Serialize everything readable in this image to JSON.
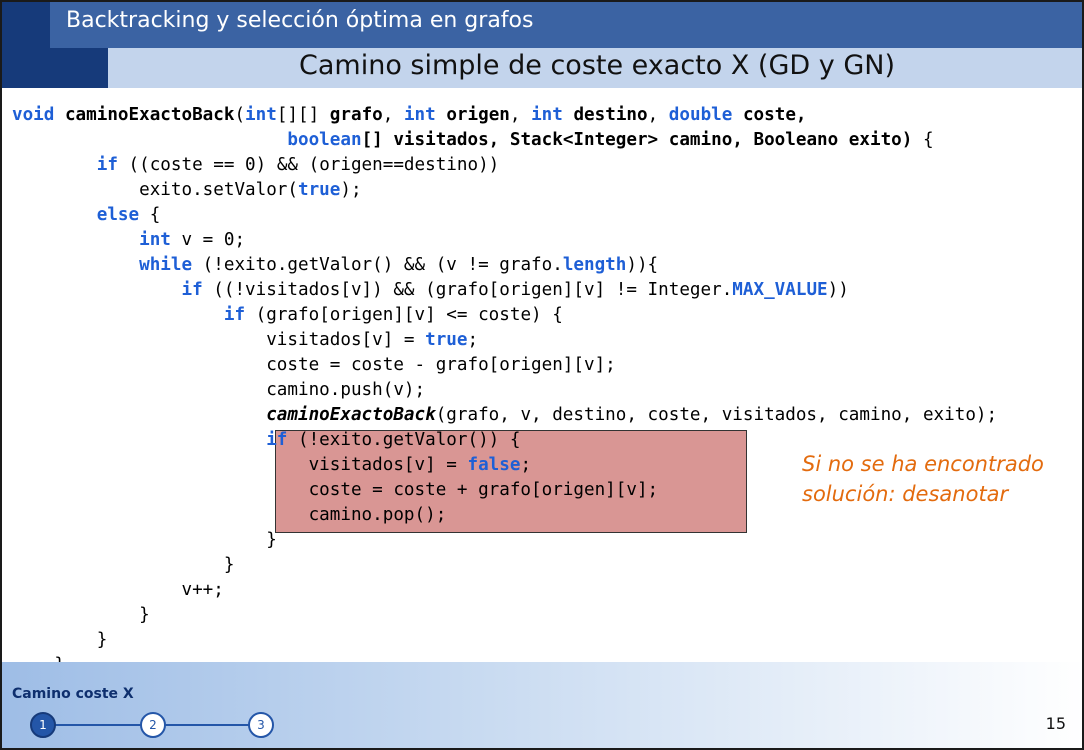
{
  "header": {
    "title": "Backtracking y selección óptima en grafos",
    "subtitle": "Camino simple de coste exacto X (GD y GN)"
  },
  "code": {
    "lines": [
      [
        {
          "t": "void",
          "c": "kw"
        },
        {
          "t": " "
        },
        {
          "t": "caminoExactoBack",
          "c": "b"
        },
        {
          "t": "("
        },
        {
          "t": "int",
          "c": "kw"
        },
        {
          "t": "[][] "
        },
        {
          "t": "grafo",
          "c": "b"
        },
        {
          "t": ", "
        },
        {
          "t": "int",
          "c": "kw"
        },
        {
          "t": " "
        },
        {
          "t": "origen",
          "c": "b"
        },
        {
          "t": ", "
        },
        {
          "t": "int",
          "c": "kw"
        },
        {
          "t": " "
        },
        {
          "t": "destino",
          "c": "b"
        },
        {
          "t": ", "
        },
        {
          "t": "double",
          "c": "kw"
        },
        {
          "t": " "
        },
        {
          "t": "coste,",
          "c": "b"
        }
      ],
      [
        {
          "t": "                          "
        },
        {
          "t": "boolean",
          "c": "kw"
        },
        {
          "t": "[] visitados, Stack<Integer> camino, Booleano exito)",
          "c": "b"
        },
        {
          "t": " {"
        }
      ],
      [
        {
          "t": "        "
        },
        {
          "t": "if",
          "c": "kw"
        },
        {
          "t": " ((coste == 0) && (origen==destino))"
        }
      ],
      [
        {
          "t": "            exito.setValor("
        },
        {
          "t": "true",
          "c": "kw"
        },
        {
          "t": ");"
        }
      ],
      [
        {
          "t": "        "
        },
        {
          "t": "else",
          "c": "kw"
        },
        {
          "t": " {"
        }
      ],
      [
        {
          "t": "            "
        },
        {
          "t": "int",
          "c": "kw"
        },
        {
          "t": " v = 0;"
        }
      ],
      [
        {
          "t": "            "
        },
        {
          "t": "while",
          "c": "kw"
        },
        {
          "t": " (!exito.getValor() && (v != grafo."
        },
        {
          "t": "length",
          "c": "kw"
        },
        {
          "t": ")){"
        }
      ],
      [
        {
          "t": "                "
        },
        {
          "t": "if",
          "c": "kw"
        },
        {
          "t": " ((!visitados[v]) && (grafo[origen][v] != Integer."
        },
        {
          "t": "MAX_VALUE",
          "c": "kw"
        },
        {
          "t": "))"
        }
      ],
      [
        {
          "t": "                    "
        },
        {
          "t": "if",
          "c": "kw"
        },
        {
          "t": " (grafo[origen][v] <= coste) {"
        }
      ],
      [
        {
          "t": "                        visitados[v] = "
        },
        {
          "t": "true",
          "c": "kw"
        },
        {
          "t": ";"
        }
      ],
      [
        {
          "t": "                        coste = coste - grafo[origen][v];"
        }
      ],
      [
        {
          "t": "                        camino.push(v);"
        }
      ],
      [
        {
          "t": "                        "
        },
        {
          "t": "caminoExactoBack",
          "c": "bi"
        },
        {
          "t": "(grafo, v, destino, coste, visitados, camino, exito);"
        }
      ],
      [
        {
          "t": "                        "
        },
        {
          "t": "if",
          "c": "kw"
        },
        {
          "t": " (!exito.getValor()) {"
        }
      ],
      [
        {
          "t": "                            visitados[v] = "
        },
        {
          "t": "false",
          "c": "kw"
        },
        {
          "t": ";"
        }
      ],
      [
        {
          "t": "                            coste = coste + grafo[origen][v];"
        }
      ],
      [
        {
          "t": "                            camino.pop();"
        }
      ],
      [
        {
          "t": "                        }"
        }
      ],
      [
        {
          "t": "                    }"
        }
      ],
      [
        {
          "t": "                v++;"
        }
      ],
      [
        {
          "t": "            }"
        }
      ],
      [
        {
          "t": "        }"
        }
      ],
      [
        {
          "t": "    }"
        }
      ]
    ]
  },
  "annotation": {
    "text": "Si no se ha encontrado solución: desanotar"
  },
  "footer": {
    "section_label": "Camino coste X",
    "steps": [
      "1",
      "2",
      "3"
    ],
    "active_step": 1,
    "page_number": "15"
  },
  "colors": {
    "keyword": "#1e5fd6",
    "highlight_box": "#d99694",
    "annotation": "#e36b0e",
    "header_dark": "#163a7a",
    "header_band": "#3b63a3",
    "subheader_band": "#c3d4ec"
  }
}
